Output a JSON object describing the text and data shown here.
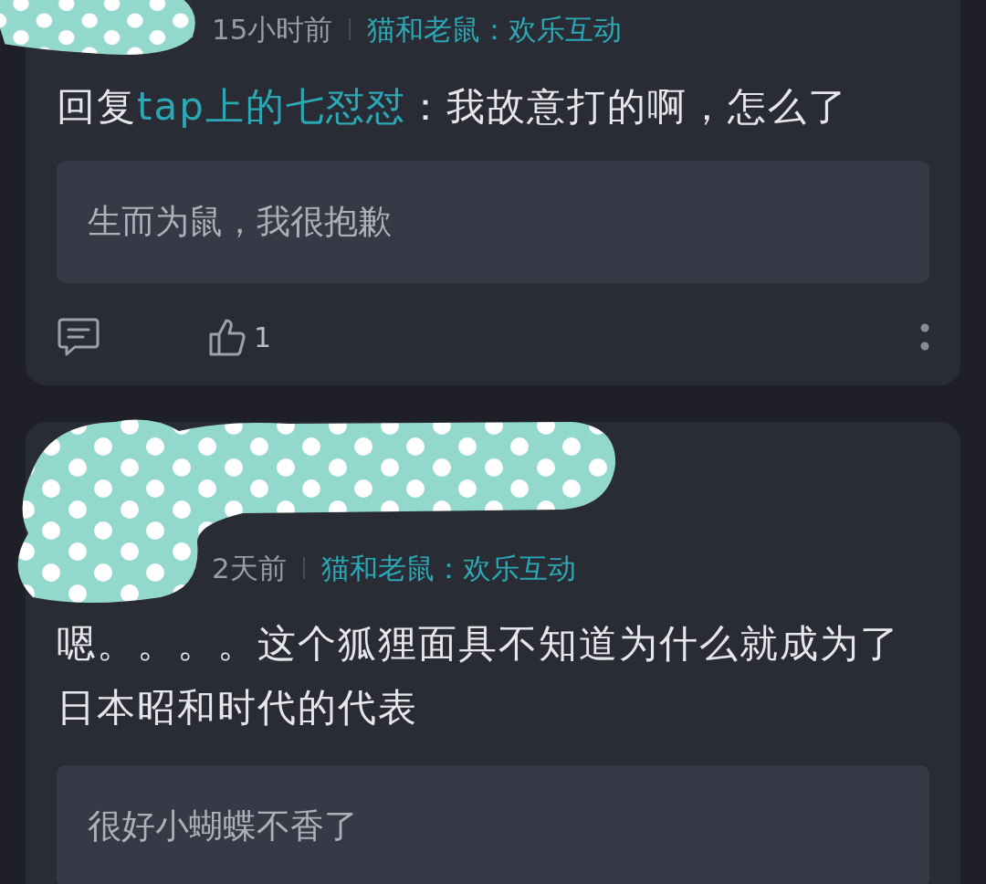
{
  "comments": [
    {
      "time": "15小时前",
      "source": "猫和老鼠：欢乐互动",
      "reply_prefix": "回复",
      "reply_to": "tap上的七怼怼",
      "text": "：我故意打的啊，怎么了",
      "quote": "生而为鼠，我很抱歉",
      "likes": "1"
    },
    {
      "time": "2天前",
      "source": "猫和老鼠：欢乐互动",
      "text": "嗯。。。。这个狐狸面具不知道为什么就成为了日本昭和时代的代表",
      "quote": "很好小蝴蝶不香了"
    }
  ]
}
